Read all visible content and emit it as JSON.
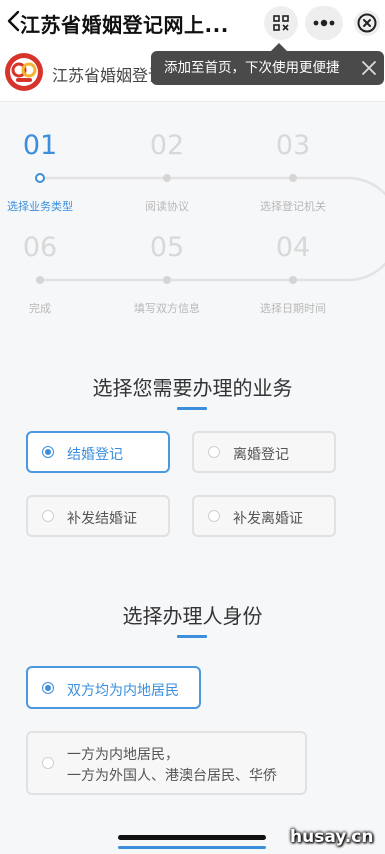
{
  "header": {
    "title": "江苏省婚姻登记网上...",
    "subtitle": "江苏省婚姻登记在线服务平台"
  },
  "tooltip": {
    "text": "添加至首页，下次使用更便捷"
  },
  "steps": [
    {
      "num": "01",
      "label": "选择业务类型",
      "active": true
    },
    {
      "num": "02",
      "label": "阅读协议",
      "active": false
    },
    {
      "num": "03",
      "label": "选择登记机关",
      "active": false
    },
    {
      "num": "04",
      "label": "选择日期时间",
      "active": false
    },
    {
      "num": "05",
      "label": "填写双方信息",
      "active": false
    },
    {
      "num": "06",
      "label": "完成",
      "active": false
    }
  ],
  "business": {
    "title": "选择您需要办理的业务",
    "options": [
      {
        "label": "结婚登记",
        "selected": true
      },
      {
        "label": "离婚登记",
        "selected": false
      },
      {
        "label": "补发结婚证",
        "selected": false
      },
      {
        "label": "补发离婚证",
        "selected": false
      }
    ]
  },
  "identity": {
    "title": "选择办理人身份",
    "options": [
      {
        "label": "双方均为内地居民",
        "selected": true
      },
      {
        "line1": "一方为内地居民，",
        "line2": "一方为外国人、港澳台居民、华侨",
        "selected": false
      }
    ]
  },
  "watermark": "husay.cn",
  "colors": {
    "accent": "#3b8fdc",
    "logo_red": "#d7342b",
    "logo_yellow": "#f2b632"
  },
  "icons": [
    "back-icon",
    "scan-icon",
    "more-icon",
    "close-icon",
    "menu-icon",
    "tooltip-close-icon"
  ]
}
